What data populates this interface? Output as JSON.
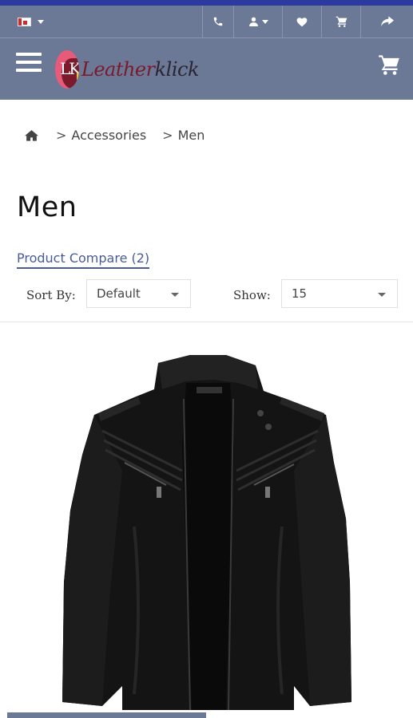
{
  "colors": {
    "header_bg": "#6b7896",
    "accent": "#2c3aa0",
    "link": "#4a5a9a"
  },
  "topbar": {
    "language": "en-GB",
    "icons": [
      "flag-icon",
      "phone-icon",
      "user-icon",
      "heart-icon",
      "cart-icon",
      "share-icon"
    ]
  },
  "header": {
    "logo_mark": "LK",
    "logo_text_first": "Leather",
    "logo_text_rest": "klick"
  },
  "breadcrumb": {
    "sep": ">",
    "items": [
      "Accessories",
      "Men"
    ]
  },
  "page": {
    "title": "Men",
    "compare_label": "Product Compare (2)"
  },
  "toolbar": {
    "sort_label": "Sort By:",
    "sort_value": "Default",
    "show_label": "Show:",
    "show_value": "15"
  },
  "product": {
    "image": "black leather biker jacket"
  }
}
